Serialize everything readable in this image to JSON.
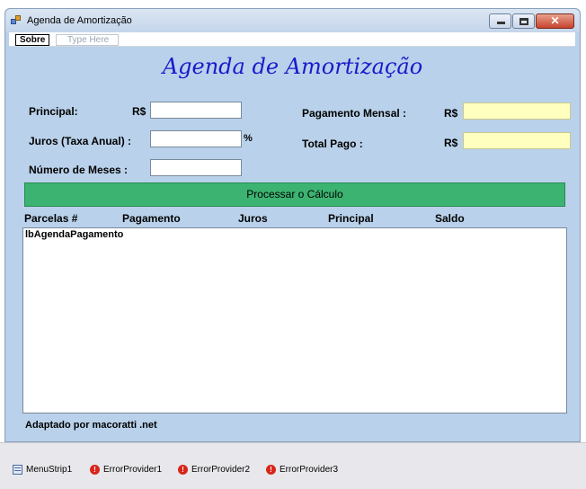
{
  "window": {
    "title": "Agenda de Amortização"
  },
  "menu": {
    "sobre": "Sobre",
    "type_here": "Type Here"
  },
  "heading": "Agenda de Amortização",
  "form": {
    "principal_label": "Principal:",
    "principal_currency": "R$",
    "juros_label": "Juros (Taxa Anual) :",
    "juros_unit": "%",
    "meses_label": "Número de Meses :",
    "pagamento_label": "Pagamento Mensal :",
    "pagamento_currency": "R$",
    "total_label": "Total Pago :",
    "total_currency": "R$"
  },
  "process_button": "Processar o Cálculo",
  "columns": [
    "Parcelas #",
    "Pagamento",
    "Juros",
    "Principal",
    "Saldo"
  ],
  "listbox": {
    "name": "lbAgendaPagamento"
  },
  "footer": "Adaptado por macoratti .net",
  "tray": {
    "items": [
      "MenuStrip1",
      "ErrorProvider1",
      "ErrorProvider2",
      "ErrorProvider3"
    ]
  },
  "colors": {
    "form_bg": "#b9d1ea",
    "heading": "#1a1acc",
    "button": "#3cb371",
    "readonly_field": "#ffffc0"
  }
}
